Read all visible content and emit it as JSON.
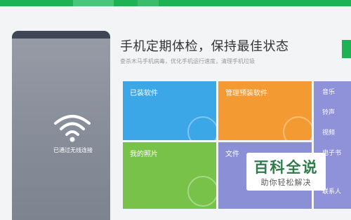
{
  "headline": "手机定期体检，保持最佳状态",
  "subline": "查杀木马手机病毒，优化手机运行速度，清理手机垃圾",
  "phone": {
    "status_text": "已通过无线连接"
  },
  "tiles": {
    "installed": "已装软件",
    "preinstalled": "管理预装软件",
    "photos": "我的照片",
    "files": "文件"
  },
  "side_list": [
    "音乐",
    "铃声",
    "视频",
    "电子书",
    "联系人"
  ],
  "watermark": {
    "title": "百科全说",
    "subtitle": "助你轻松解决"
  },
  "colors": {
    "brand_green": "#1db254",
    "tile_blue": "#3ca7e6",
    "tile_orange": "#f39b32",
    "tile_green": "#78c24a",
    "tile_purple": "#8a8fd6"
  }
}
